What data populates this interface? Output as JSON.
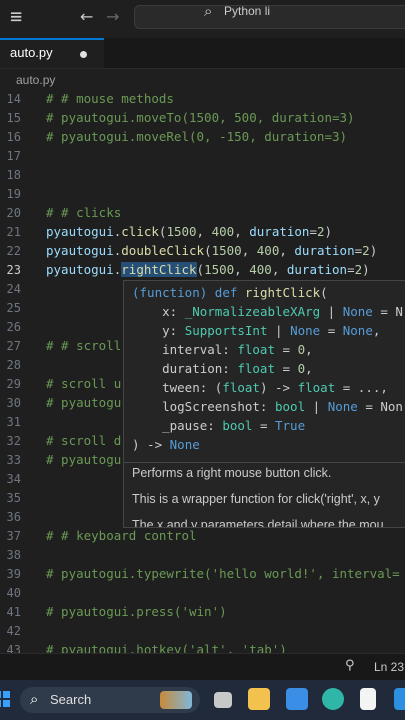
{
  "titlebar": {
    "menu_icon": "hamburger-icon",
    "back_icon": "arrow-left-icon",
    "forward_icon": "arrow-right-icon",
    "command_center_text": "Python li"
  },
  "tab": {
    "label": "auto.py",
    "modified_dot": "●"
  },
  "breadcrumb": "auto.py",
  "lines": [
    {
      "n": "14",
      "t": "# # mouse methods"
    },
    {
      "n": "15",
      "t": "# pyautogui.moveTo(1500, 500, duration=3)"
    },
    {
      "n": "16",
      "t": "# pyautogui.moveRel(0, -150, duration=3)"
    },
    {
      "n": "17",
      "t": ""
    },
    {
      "n": "18",
      "t": ""
    },
    {
      "n": "19",
      "t": ""
    },
    {
      "n": "20",
      "t": "# # clicks"
    },
    {
      "n": "21",
      "t": "pyautogui.click(1500, 400, duration=2)"
    },
    {
      "n": "22",
      "t": "pyautogui.doubleClick(1500, 400, duration=2)"
    },
    {
      "n": "23",
      "t": "pyautogui.rightClick(1500, 400, duration=2)"
    },
    {
      "n": "24",
      "t": ""
    },
    {
      "n": "25",
      "t": ""
    },
    {
      "n": "26",
      "t": ""
    },
    {
      "n": "27",
      "t": "# # scroll"
    },
    {
      "n": "28",
      "t": ""
    },
    {
      "n": "29",
      "t": "# scroll u"
    },
    {
      "n": "30",
      "t": "# pyautogu"
    },
    {
      "n": "31",
      "t": ""
    },
    {
      "n": "32",
      "t": "# scroll d"
    },
    {
      "n": "33",
      "t": "# pyautogu"
    },
    {
      "n": "34",
      "t": ""
    },
    {
      "n": "35",
      "t": ""
    },
    {
      "n": "36",
      "t": ""
    },
    {
      "n": "37",
      "t": "# # keyboard control"
    },
    {
      "n": "38",
      "t": ""
    },
    {
      "n": "39",
      "t": "# pyautogui.typewrite('hello world!', interval="
    },
    {
      "n": "40",
      "t": ""
    },
    {
      "n": "41",
      "t": "# pyautogui.press('win')"
    },
    {
      "n": "42",
      "t": ""
    },
    {
      "n": "43",
      "t": "# pyautogui.hotkey('alt', 'tab')"
    }
  ],
  "hover": {
    "signature": [
      "(function) def rightClick(",
      "    x: _NormalizeableXArg | None = N",
      "    y: SupportsInt | None = None,",
      "    interval: float = 0,",
      "    duration: float = 0,",
      "    tween: (float) -> float = ...,",
      "    logScreenshot: bool | None = Non",
      "    _pause: bool = True",
      ") -> None"
    ],
    "doc": [
      "Performs a right mouse button click.",
      "This is a wrapper function for click('right', x, y",
      "The x and y parameters detail where the mou"
    ]
  },
  "statusbar": {
    "icon": "source-control-icon",
    "position": "Ln 23,"
  },
  "taskbar": {
    "search_label": "Search",
    "search_icon": "search-icon"
  }
}
